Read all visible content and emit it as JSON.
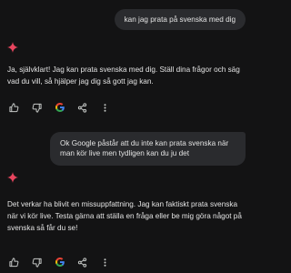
{
  "conversation": {
    "user_message_1": "kan jag prata på svenska med dig",
    "reply_1": "Ja, självklart! Jag kan prata svenska med dig. Ställ dina frågor och säg vad du vill, så hjälper jag dig så gott jag kan.",
    "user_message_2": "Ok Google påstår att du inte kan prata svenska när man kör live men tydligen kan du ju det",
    "reply_2": "Det verkar ha blivit en missuppfattning. Jag kan faktiskt prata svenska när vi kör live. Testa gärna att ställa en fråga eller be mig göra något på svenska så får du se!"
  },
  "icons": {
    "assistant_avatar": "gemini-sparkle-icon",
    "thumbs_up": "thumbs-up-icon",
    "thumbs_down": "thumbs-down-icon",
    "google": "google-g-icon",
    "share": "share-icon",
    "more": "more-vertical-icon"
  },
  "colors": {
    "background": "#131314",
    "user_bubble": "#2a2b2e",
    "text": "#e3e3e3",
    "icon": "#c4c7c5",
    "sparkle": "#e8455e"
  }
}
